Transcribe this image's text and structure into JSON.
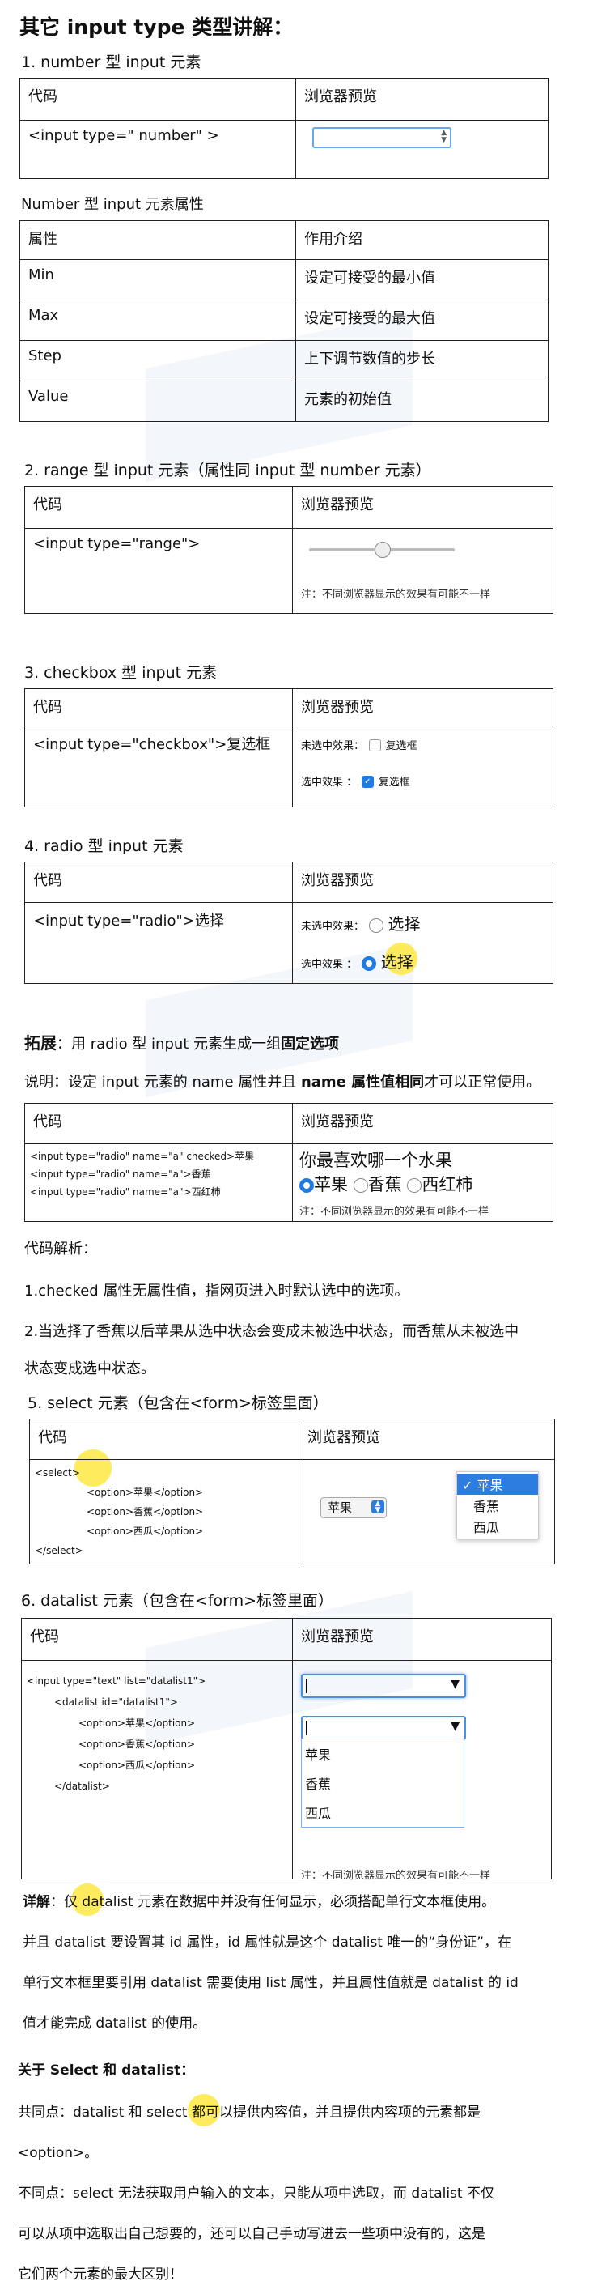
{
  "title": "其它 input type 类型讲解：",
  "number": {
    "heading": "1.  number 型 input 元素",
    "col_code": "代码",
    "col_preview": "浏览器预览",
    "code": "<input type=\"  number\"  >",
    "attr_heading": "Number 型 input 元素属性",
    "attr_header": [
      "属性",
      "作用介绍"
    ],
    "attrs": [
      [
        "Min",
        "设定可接受的最小值"
      ],
      [
        "Max",
        "设定可接受的最大值"
      ],
      [
        "Step",
        "上下调节数值的步长"
      ],
      [
        "Value",
        "元素的初始值"
      ]
    ]
  },
  "range": {
    "heading": "2.  range 型 input 元素（属性同 input 型 number 元素）",
    "col_code": "代码",
    "col_preview": "浏览器预览",
    "code": "<input type=\"range\">",
    "note": "注：不同浏览器显示的效果有可能不一样",
    "slider_value": 0.5
  },
  "checkbox": {
    "heading": "3.  checkbox 型 input 元素",
    "col_code": "代码",
    "col_preview": "浏览器预览",
    "code": "<input type=\"checkbox\">复选框",
    "unchecked_label": "未选中效果：",
    "checked_label": "选中效果  ：",
    "box_text": "复选框"
  },
  "radio": {
    "heading": "4.  radio 型 input 元素",
    "col_code": "代码",
    "col_preview": "浏览器预览",
    "code": "<input type=\"radio\">选择",
    "unchecked_label": "未选中效果：",
    "checked_label": "选中效果   ：",
    "radio_text": "选择"
  },
  "extend": {
    "label": "拓展",
    "text": "：用 radio 型 input 元素生成一组",
    "bold": "固定选项",
    "explain_prefix": "说明：设定 input 元素的 name 属性并且 ",
    "explain_bold": "name 属性值相同",
    "explain_suffix": "才可以正常使用。",
    "col_code": "代码",
    "col_preview": "浏览器预览",
    "code_lines": [
      "<input type=\"radio\" name=\"a\" checked>苹果",
      "<input type=\"radio\" name=\"a\">香蕉",
      "<input type=\"radio\" name=\"a\">西红柿"
    ],
    "question": "你最喜欢哪一个水果",
    "options": [
      "苹果",
      "香蕉",
      "西红柿"
    ],
    "note": "注：不同浏览器显示的效果有可能不一样"
  },
  "analysis": {
    "heading": "代码解析：",
    "point1": "1.checked 属性无属性值，指网页进入时默认选中的选项。",
    "point2_line1": "2.当选择了香蕉以后苹果从选中状态会变成未被选中状态，而香蕉从未被选中",
    "point2_line2": "状态变成选中状态。"
  },
  "select": {
    "heading": "5.  select 元素（包含在<form>标签里面）",
    "col_code": "代码",
    "col_preview": "浏览器预览",
    "code_lines": [
      "<select>",
      "<option>苹果</option>",
      "<option>香蕉</option>",
      "<option>西瓜</option>",
      "</select>"
    ],
    "selected": "苹果",
    "options": [
      "苹果",
      "香蕉",
      "西瓜"
    ]
  },
  "datalist": {
    "heading": "6.  datalist 元素（包含在<form>标签里面）",
    "col_code": "代码",
    "col_preview": "浏览器预览",
    "code_lines": [
      "<input type=\"text\" list=\"datalist1\">",
      "<datalist id=\"datalist1\">",
      "<option>苹果</option>",
      "<option>香蕉</option>",
      "<option>西瓜</option>",
      "</datalist>"
    ],
    "options": [
      "苹果",
      "香蕉",
      "西瓜"
    ],
    "note": "注：不同浏览器显示的效果有可能不一样"
  },
  "detail": {
    "label": "详解",
    "line1": "：仅 datalist 元素在数据中并没有任何显示，必须搭配单行文本框使用。",
    "line2": "并且 datalist 要设置其 id 属性，id 属性就是这个 datalist 唯一的“身份证”，在",
    "line3": "单行文本框里要引用 datalist 需要使用 list 属性，并且属性值就是 datalist 的 id",
    "line4": "值才能完成 datalist 的使用。"
  },
  "compare": {
    "heading": "关于 Select 和 datalist：",
    "same_line1": "共同点：datalist 和 select 都可以提供内容值，并且提供内容项的元素都是",
    "same_line2": "<option>。",
    "diff_line1": "不同点：select 无法获取用户输入的文本，只能从项中选取，而 datalist 不仅",
    "diff_line2": "可以从项中选取出自己想要的，还可以自己手动写进去一些项中没有的，这是",
    "diff_line3": "它们两个元素的最大区别！"
  }
}
